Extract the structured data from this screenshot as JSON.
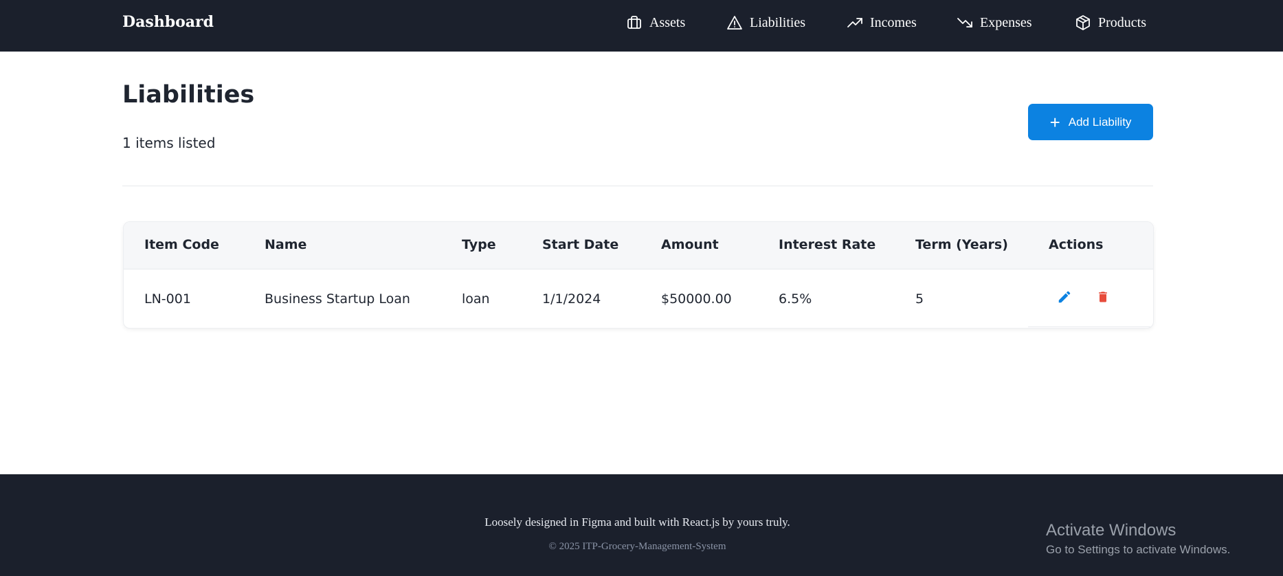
{
  "navbar": {
    "brand": "Dashboard",
    "links": [
      {
        "label": "Assets",
        "icon": "briefcase-icon"
      },
      {
        "label": "Liabilities",
        "icon": "warning-triangle-icon"
      },
      {
        "label": "Incomes",
        "icon": "trending-up-icon"
      },
      {
        "label": "Expenses",
        "icon": "trending-down-icon"
      },
      {
        "label": "Products",
        "icon": "box-icon"
      }
    ]
  },
  "page": {
    "title": "Liabilities",
    "count_text": "1 items listed",
    "add_button_label": "Add Liability"
  },
  "table": {
    "columns": [
      "Item Code",
      "Name",
      "Type",
      "Start Date",
      "Amount",
      "Interest Rate",
      "Term (Years)",
      "Actions"
    ],
    "rows": [
      {
        "item_code": "LN-001",
        "name": "Business Startup Loan",
        "type": "loan",
        "start_date": "1/1/2024",
        "amount": "$50000.00",
        "interest_rate": "6.5%",
        "term_years": "5"
      }
    ]
  },
  "footer": {
    "tagline": "Loosely designed in Figma and built with React.js by yours truly.",
    "copyright": "© 2025 ITP-Grocery-Management-System"
  },
  "watermark": {
    "title": "Activate Windows",
    "subtitle": "Go to Settings to activate Windows."
  },
  "colors": {
    "navbar_bg": "#1b202c",
    "primary": "#0c82e1",
    "danger": "#e74c3c"
  }
}
